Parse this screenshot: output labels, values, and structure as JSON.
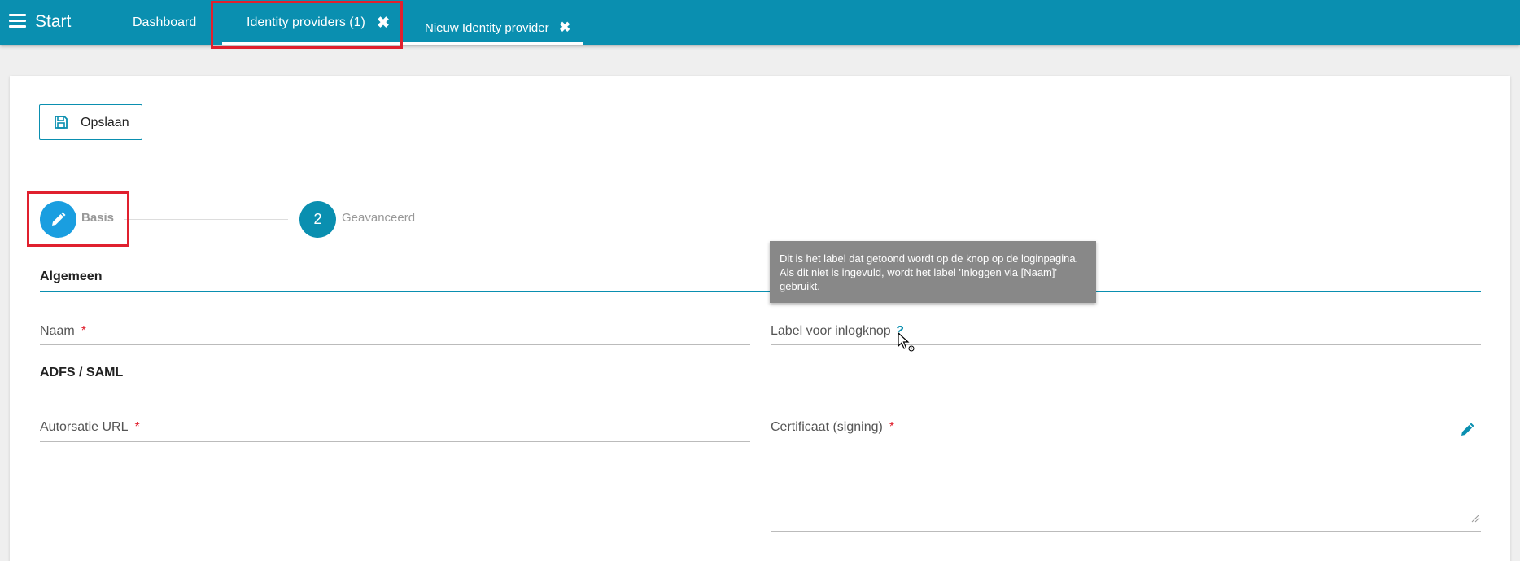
{
  "topbar": {
    "menu_icon": "hamburger-menu-icon",
    "start_label": "Start",
    "tabs": [
      {
        "label": "Dashboard"
      },
      {
        "label": "Identity providers (1)",
        "close_glyph": "✖"
      },
      {
        "label": "Nieuw Identity provider",
        "close_glyph": "✖"
      }
    ]
  },
  "toolbar": {
    "save_label": "Opslaan",
    "save_icon": "floppy-disk-icon"
  },
  "stepper": {
    "steps": [
      {
        "label": "Basis",
        "icon": "pencil-icon"
      },
      {
        "number": "2",
        "label": "Geavanceerd"
      }
    ]
  },
  "sections": {
    "general": {
      "title": "Algemeen"
    },
    "adfs": {
      "title": "ADFS / SAML"
    }
  },
  "fields": {
    "name": {
      "label": "Naam",
      "required": "*"
    },
    "login_label": {
      "label": "Label voor inlogknop",
      "help": "?"
    },
    "auth_url": {
      "label": "Autorsatie URL",
      "required": "*"
    },
    "certificate": {
      "label": "Certificaat (signing)",
      "required": "*"
    }
  },
  "tooltip": {
    "text": "Dit is het label dat getoond wordt op de knop op de loginpagina. Als dit niet is ingevuld, wordt het label 'Inloggen via [Naam]' gebruikt."
  },
  "colors": {
    "primary": "#0a8fb0",
    "step_active": "#1a9ee0",
    "required": "#e0202e",
    "highlight": "#e0202e",
    "tooltip_bg": "#888888"
  }
}
